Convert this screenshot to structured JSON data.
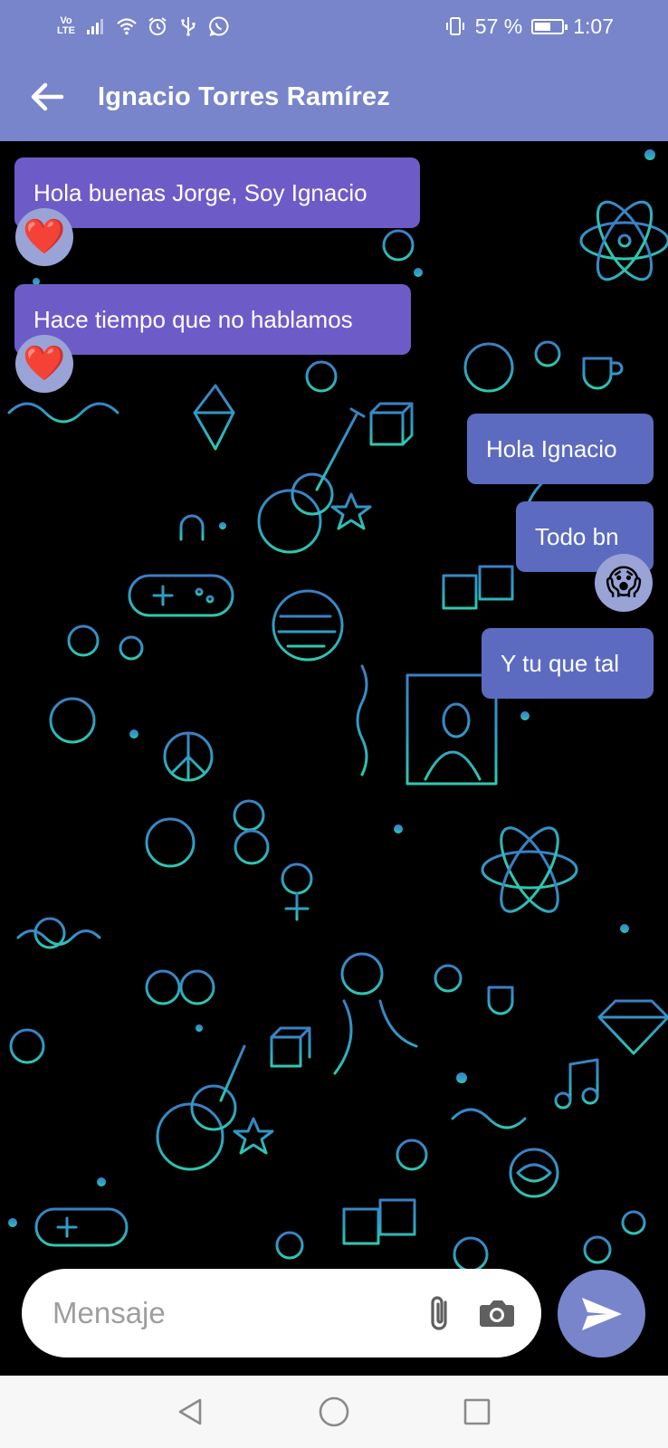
{
  "status_bar": {
    "volte": "Vo LTE",
    "battery_text": "57 %",
    "battery_level": 0.57,
    "time": "1:07",
    "left_icons": [
      "signal-icon",
      "wifi-icon",
      "alarm-icon",
      "usb-icon",
      "whatsapp-icon"
    ],
    "right_icons": [
      "vibrate-icon",
      "battery-icon"
    ]
  },
  "header": {
    "contact_name": "Ignacio Torres Ramírez",
    "back_icon": "arrow-back-icon"
  },
  "messages": [
    {
      "direction": "incoming",
      "text": "Hola buenas Jorge, Soy Ignacio",
      "reaction": "❤️"
    },
    {
      "direction": "incoming",
      "text": "Hace tiempo que no hablamos",
      "reaction": "❤️"
    },
    {
      "direction": "outgoing",
      "text": "Hola Ignacio",
      "reaction": ""
    },
    {
      "direction": "outgoing",
      "text": "Todo bn",
      "reaction": "😱"
    },
    {
      "direction": "outgoing",
      "text": "Y tu que tal",
      "reaction": ""
    }
  ],
  "composer": {
    "placeholder": "Mensaje",
    "value": "",
    "attach_icon": "paperclip-icon",
    "camera_icon": "camera-icon",
    "send_icon": "send-icon"
  },
  "nav": {
    "back_icon": "nav-back-icon",
    "home_icon": "nav-home-icon",
    "recents_icon": "nav-recents-icon"
  },
  "colors": {
    "header": "#7885cb",
    "incoming_bubble": "#6d5cc8",
    "outgoing_bubble": "#5c6bc0",
    "send_button": "#7885cb",
    "wallpaper_doodles_top": "#3b82c4",
    "wallpaper_doodles_bottom": "#2fbfae"
  }
}
